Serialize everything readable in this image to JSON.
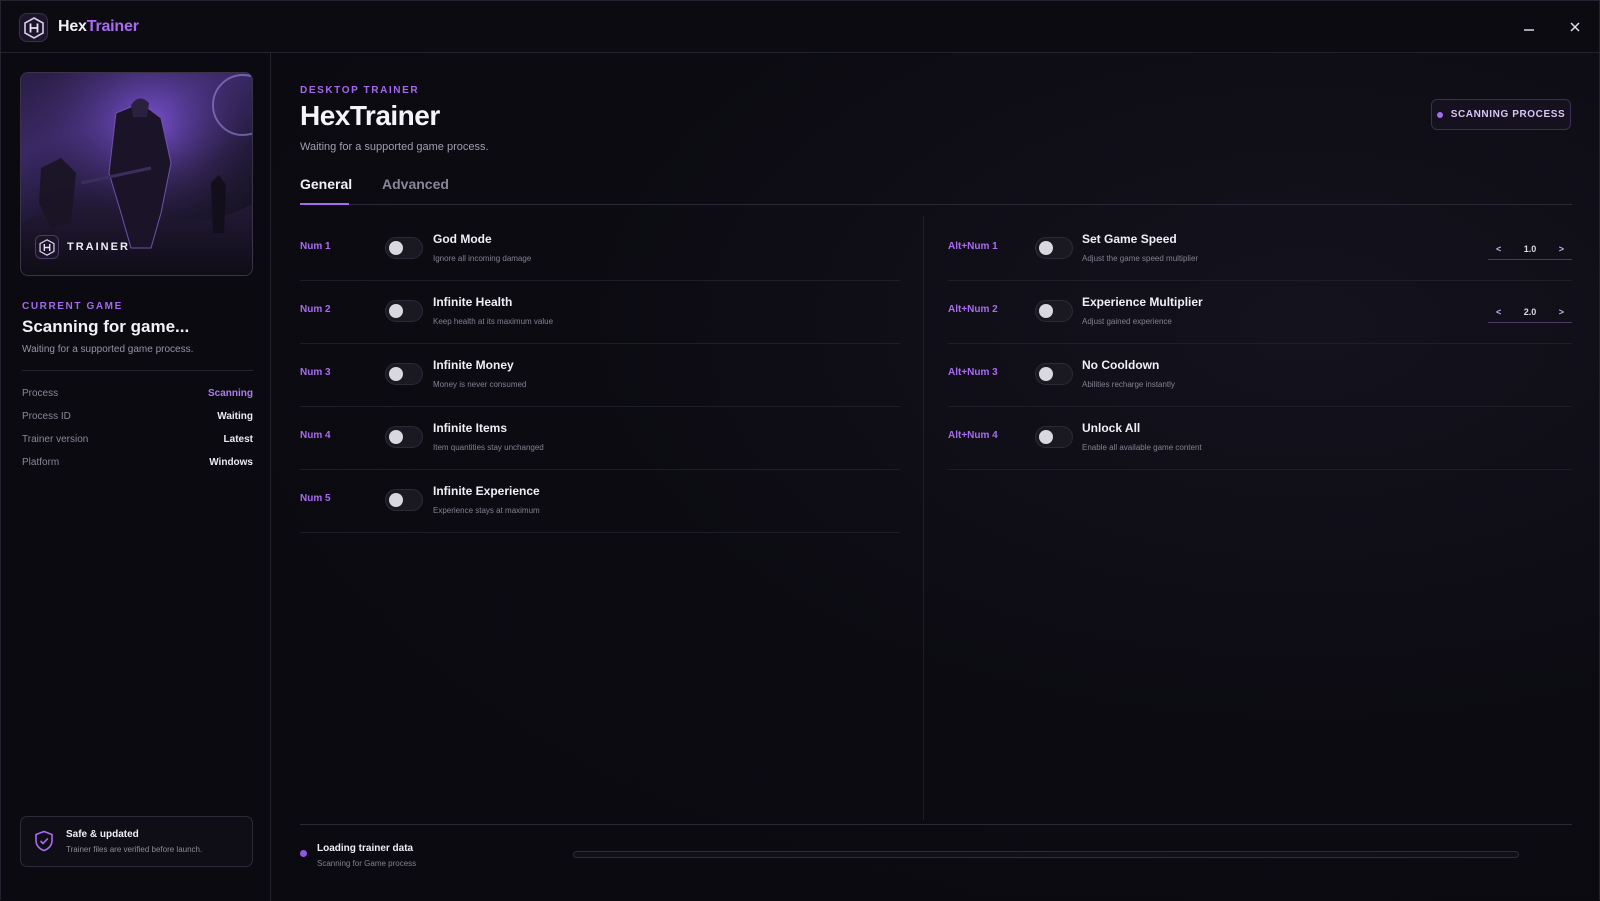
{
  "app": {
    "title_part1": "Hex",
    "title_part2": "Trainer"
  },
  "window": {
    "minimize": "—",
    "close": "✕"
  },
  "sidebar": {
    "cover_label": "TRAINER",
    "current_game_eyebrow": "CURRENT GAME",
    "current_game_title": "Scanning for game...",
    "current_game_sub": "Waiting for a supported game process.",
    "info": [
      {
        "key": "Process",
        "value": "Scanning"
      },
      {
        "key": "Process ID",
        "value": "Waiting"
      },
      {
        "key": "Trainer version",
        "value": "Latest"
      },
      {
        "key": "Platform",
        "value": "Windows"
      }
    ],
    "safe_title": "Safe & updated",
    "safe_sub": "Trainer files are verified before launch."
  },
  "main": {
    "eyebrow": "DESKTOP TRAINER",
    "title": "HexTrainer",
    "subtitle": "Waiting for a supported game process.",
    "status_pill": "SCANNING PROCESS",
    "tabs": [
      {
        "label": "General"
      },
      {
        "label": "Advanced"
      }
    ],
    "left_cheats": [
      {
        "hotkey": "Num 1",
        "name": "God Mode",
        "desc": "Ignore all incoming damage"
      },
      {
        "hotkey": "Num 2",
        "name": "Infinite Health",
        "desc": "Keep health at its maximum value"
      },
      {
        "hotkey": "Num 3",
        "name": "Infinite Money",
        "desc": "Money is never consumed"
      },
      {
        "hotkey": "Num 4",
        "name": "Infinite Items",
        "desc": "Item quantities stay unchanged"
      },
      {
        "hotkey": "Num 5",
        "name": "Infinite Experience",
        "desc": "Experience stays at maximum"
      }
    ],
    "right_cheats": [
      {
        "hotkey": "Alt+Num 1",
        "name": "Set Game Speed",
        "desc": "Adjust the game speed multiplier",
        "value": "1.0"
      },
      {
        "hotkey": "Alt+Num 2",
        "name": "Experience Multiplier",
        "desc": "Adjust gained experience",
        "value": "2.0"
      },
      {
        "hotkey": "Alt+Num 3",
        "name": "No Cooldown",
        "desc": "Abilities recharge instantly"
      },
      {
        "hotkey": "Alt+Num 4",
        "name": "Unlock All",
        "desc": "Enable all available game content"
      }
    ],
    "stepper_prev": "<",
    "stepper_next": ">",
    "footer": {
      "title": "Loading trainer data",
      "sub": "Scanning for Game process",
      "progress": 0
    }
  },
  "colors": {
    "accent": "#a86bf0",
    "background": "#0b0b12"
  }
}
